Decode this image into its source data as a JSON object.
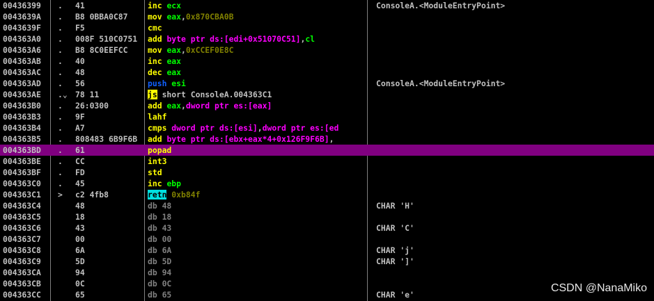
{
  "rows": [
    {
      "addr": "00436399",
      "mark": ".",
      "hex": "41",
      "mnemonic": "inc",
      "mstyle": "mn",
      "operands": [
        {
          "t": "ecx",
          "k": "op-reg"
        }
      ],
      "comment": "ConsoleA.<ModuleEntryPoint>",
      "selected": false
    },
    {
      "addr": "0043639A",
      "mark": ".",
      "hex": "B8 0BBA0C87",
      "mnemonic": "mov",
      "mstyle": "mn",
      "operands": [
        {
          "t": "eax",
          "k": "op-reg"
        },
        {
          "t": ",",
          "k": "op-plain"
        },
        {
          "t": "0x870CBA0B",
          "k": "op-num"
        }
      ],
      "comment": "",
      "selected": false
    },
    {
      "addr": "0043639F",
      "mark": ".",
      "hex": "F5",
      "mnemonic": "cmc",
      "mstyle": "mn",
      "operands": [],
      "comment": "",
      "selected": false
    },
    {
      "addr": "004363A0",
      "mark": ".",
      "hex": "008F 510C0751",
      "mnemonic": "add",
      "mstyle": "mn",
      "operands": [
        {
          "t": "byte ptr ds:[edi+0x51070C51]",
          "k": "op-mem"
        },
        {
          "t": ",",
          "k": "op-plain"
        },
        {
          "t": "cl",
          "k": "op-reg"
        }
      ],
      "comment": "",
      "selected": false
    },
    {
      "addr": "004363A6",
      "mark": ".",
      "hex": "B8 8C0EEFCC",
      "mnemonic": "mov",
      "mstyle": "mn",
      "operands": [
        {
          "t": "eax",
          "k": "op-reg"
        },
        {
          "t": ",",
          "k": "op-plain"
        },
        {
          "t": "0xCCEF0E8C",
          "k": "op-num"
        }
      ],
      "comment": "",
      "selected": false
    },
    {
      "addr": "004363AB",
      "mark": ".",
      "hex": "40",
      "mnemonic": "inc",
      "mstyle": "mn",
      "operands": [
        {
          "t": "eax",
          "k": "op-reg"
        }
      ],
      "comment": "",
      "selected": false
    },
    {
      "addr": "004363AC",
      "mark": ".",
      "hex": "48",
      "mnemonic": "dec",
      "mstyle": "mn",
      "operands": [
        {
          "t": "eax",
          "k": "op-reg"
        }
      ],
      "comment": "",
      "selected": false
    },
    {
      "addr": "004363AD",
      "mark": ".",
      "hex": "56",
      "mnemonic": "push",
      "mstyle": "mn-push",
      "operands": [
        {
          "t": "esi",
          "k": "op-reg"
        }
      ],
      "comment": "ConsoleA.<ModuleEntryPoint>",
      "selected": false
    },
    {
      "addr": "004363AE",
      "mark": ".⌄",
      "hex": "78 11",
      "mnemonic": "js",
      "mstyle": "mn-jmp",
      "operands": [
        {
          "t": "short ConsoleA.004363C1",
          "k": "op-plain"
        }
      ],
      "comment": "",
      "selected": false
    },
    {
      "addr": "004363B0",
      "mark": ".",
      "hex": "26:0300",
      "mnemonic": "add",
      "mstyle": "mn",
      "operands": [
        {
          "t": "eax",
          "k": "op-reg"
        },
        {
          "t": ",",
          "k": "op-plain"
        },
        {
          "t": "dword ptr es:[eax]",
          "k": "op-mem"
        }
      ],
      "comment": "",
      "selected": false
    },
    {
      "addr": "004363B3",
      "mark": ".",
      "hex": "9F",
      "mnemonic": "lahf",
      "mstyle": "mn",
      "operands": [],
      "comment": "",
      "selected": false
    },
    {
      "addr": "004363B4",
      "mark": ".",
      "hex": "A7",
      "mnemonic": "cmps",
      "mstyle": "mn",
      "operands": [
        {
          "t": "dword ptr ds:[esi]",
          "k": "op-mem"
        },
        {
          "t": ",",
          "k": "op-plain"
        },
        {
          "t": "dword ptr es:[ed",
          "k": "op-mem"
        }
      ],
      "comment": "",
      "selected": false
    },
    {
      "addr": "004363B5",
      "mark": ".",
      "hex": "808483 6B9F6B",
      "mnemonic": "add",
      "mstyle": "mn",
      "operands": [
        {
          "t": "byte ptr ds:[ebx+eax*4+0x126F9F6B]",
          "k": "op-mem"
        },
        {
          "t": ",",
          "k": "op-plain"
        }
      ],
      "comment": "",
      "selected": false
    },
    {
      "addr": "004363BD",
      "mark": ".",
      "hex": "61",
      "mnemonic": "popad",
      "mstyle": "mn",
      "operands": [],
      "comment": "",
      "selected": true
    },
    {
      "addr": "004363BE",
      "mark": ".",
      "hex": "CC",
      "mnemonic": "int3",
      "mstyle": "mn",
      "operands": [],
      "comment": "",
      "selected": false
    },
    {
      "addr": "004363BF",
      "mark": ".",
      "hex": "FD",
      "mnemonic": "std",
      "mstyle": "mn",
      "operands": [],
      "comment": "",
      "selected": false
    },
    {
      "addr": "004363C0",
      "mark": ".",
      "hex": "45",
      "mnemonic": "inc",
      "mstyle": "mn",
      "operands": [
        {
          "t": "ebp",
          "k": "op-reg"
        }
      ],
      "comment": "",
      "selected": false
    },
    {
      "addr": "004363C1",
      "mark": ">",
      "hex": "c2 4fb8",
      "mnemonic": "retn",
      "mstyle": "mn-ret",
      "operands": [
        {
          "t": "0xb84f",
          "k": "op-num"
        }
      ],
      "comment": "",
      "selected": false
    },
    {
      "addr": "004363C4",
      "mark": "",
      "hex": "48",
      "mnemonic": "db",
      "mstyle": "mn-db",
      "operands": [
        {
          "t": "48",
          "k": "op-db"
        }
      ],
      "comment": "CHAR 'H'",
      "selected": false
    },
    {
      "addr": "004363C5",
      "mark": "",
      "hex": "18",
      "mnemonic": "db",
      "mstyle": "mn-db",
      "operands": [
        {
          "t": "18",
          "k": "op-db"
        }
      ],
      "comment": "",
      "selected": false
    },
    {
      "addr": "004363C6",
      "mark": "",
      "hex": "43",
      "mnemonic": "db",
      "mstyle": "mn-db",
      "operands": [
        {
          "t": "43",
          "k": "op-db"
        }
      ],
      "comment": "CHAR 'C'",
      "selected": false
    },
    {
      "addr": "004363C7",
      "mark": "",
      "hex": "00",
      "mnemonic": "db",
      "mstyle": "mn-db",
      "operands": [
        {
          "t": "00",
          "k": "op-db"
        }
      ],
      "comment": "",
      "selected": false
    },
    {
      "addr": "004363C8",
      "mark": "",
      "hex": "6A",
      "mnemonic": "db",
      "mstyle": "mn-db",
      "operands": [
        {
          "t": "6A",
          "k": "op-db"
        }
      ],
      "comment": "CHAR 'j'",
      "selected": false
    },
    {
      "addr": "004363C9",
      "mark": "",
      "hex": "5D",
      "mnemonic": "db",
      "mstyle": "mn-db",
      "operands": [
        {
          "t": "5D",
          "k": "op-db"
        }
      ],
      "comment": "CHAR ']'",
      "selected": false
    },
    {
      "addr": "004363CA",
      "mark": "",
      "hex": "94",
      "mnemonic": "db",
      "mstyle": "mn-db",
      "operands": [
        {
          "t": "94",
          "k": "op-db"
        }
      ],
      "comment": "",
      "selected": false
    },
    {
      "addr": "004363CB",
      "mark": "",
      "hex": "0C",
      "mnemonic": "db",
      "mstyle": "mn-db",
      "operands": [
        {
          "t": "0C",
          "k": "op-db"
        }
      ],
      "comment": "",
      "selected": false
    },
    {
      "addr": "004363CC",
      "mark": "",
      "hex": "65",
      "mnemonic": "db",
      "mstyle": "mn-db",
      "operands": [
        {
          "t": "65",
          "k": "op-db"
        }
      ],
      "comment": "CHAR 'e'",
      "selected": false
    }
  ],
  "watermark": "CSDN @NanaMiko",
  "colors": {
    "background": "#000000",
    "selection": "#800080",
    "mnemonic": "#ffff00",
    "register": "#00ff00",
    "memory": "#ff00ff",
    "number": "#808000",
    "jump_highlight": "#ffff00",
    "return_highlight": "#00e0e0",
    "push": "#1060ff",
    "data_byte": "#808080",
    "text": "#c0c0c0"
  }
}
